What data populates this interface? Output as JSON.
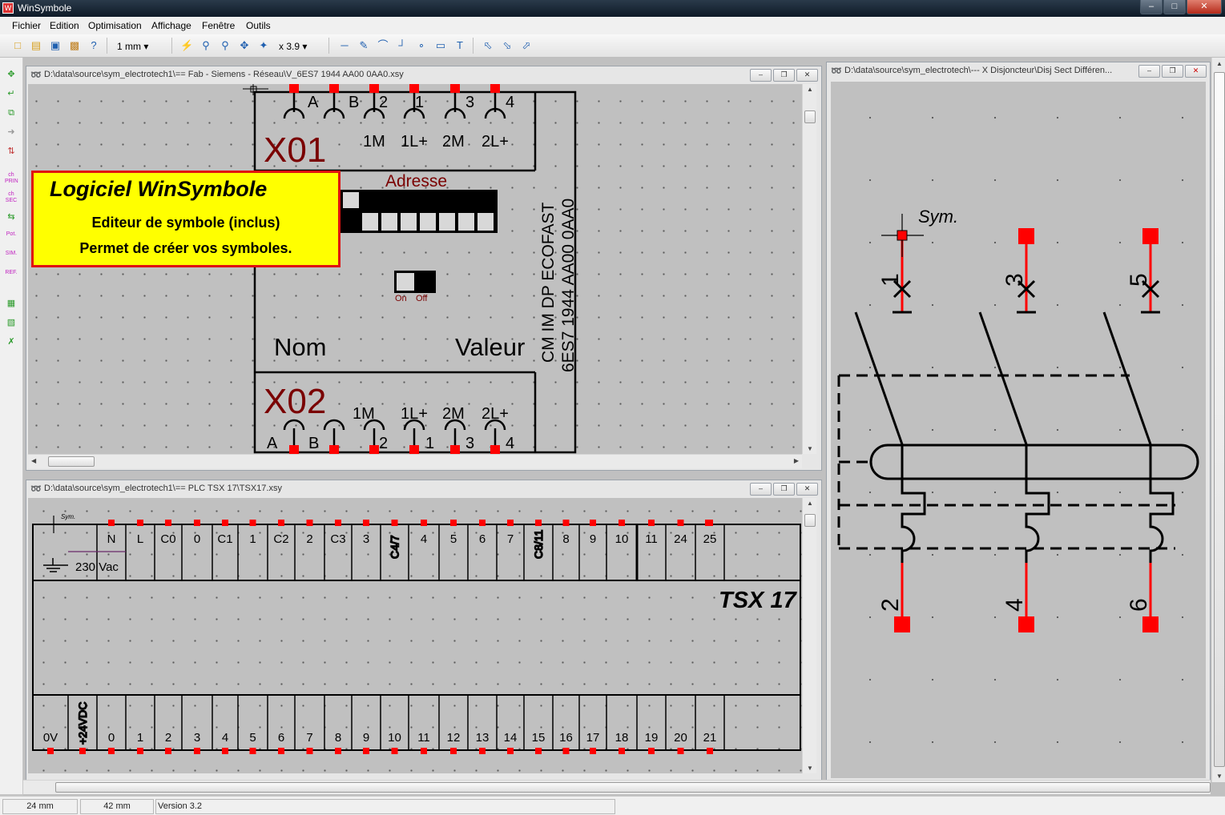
{
  "app": {
    "title": "WinSymbole"
  },
  "menu": [
    "Fichier",
    "Edition",
    "Optimisation",
    "Affichage",
    "Fenêtre",
    "Outils"
  ],
  "toolbar": {
    "grid_size": "1 mm",
    "zoom": "x 3.9"
  },
  "left_toolbar": {
    "labels": [
      "ch PRIN",
      "ch SEC",
      "Pot.",
      "SIM.",
      "REF."
    ]
  },
  "windows": {
    "siemens": {
      "title": "D:\\data\\source\\sym_electrotech1\\== Fab - Siemens - Réseau\\V_6ES7 1944 AA00 0AA0.xsy",
      "top_pins": [
        "A",
        "B",
        "2",
        "1",
        "3",
        "4"
      ],
      "top_labels": [
        "1M",
        "1L+",
        "2M",
        "2L+"
      ],
      "block1": "X01",
      "block2": "X02",
      "adresse": "Adresse",
      "switch_on": "On",
      "switch_off": "Off",
      "nom": "Nom",
      "valeur": "Valeur",
      "vertical1": "CM IM DP ECOFAST",
      "vertical2": "6ES7 1944 AA00 0AA0",
      "bottom_labels": [
        "1M",
        "1L+",
        "2M",
        "2L+"
      ],
      "bottom_pins": [
        "A",
        "B",
        "2",
        "1",
        "3",
        "4"
      ]
    },
    "disj": {
      "title": "D:\\data\\source\\sym_electrotech\\--- X Disjoncteur\\Disj Sect Différen...",
      "sym": "Sym.",
      "top_numbers": [
        "1",
        "3",
        "5"
      ],
      "bottom_numbers": [
        "2",
        "4",
        "6"
      ]
    },
    "tsx": {
      "title": "D:\\data\\source\\sym_electrotech1\\== PLC TSX 17\\TSX17.xsy",
      "sym": "Sym.",
      "top_terms": [
        "N",
        "L",
        "C0",
        "0",
        "C1",
        "1",
        "C2",
        "2",
        "C3",
        "3",
        "C4/7",
        "4",
        "5",
        "6",
        "7",
        "C8/11",
        "8",
        "9",
        "10",
        "11",
        "24",
        "25"
      ],
      "supply": "230 Vac",
      "model": "TSX 17",
      "bottom_terms": [
        "0V",
        "+24VDC",
        "0",
        "1",
        "2",
        "3",
        "4",
        "5",
        "6",
        "7",
        "8",
        "9",
        "10",
        "11",
        "12",
        "13",
        "14",
        "15",
        "16",
        "17",
        "18",
        "19",
        "20",
        "21"
      ]
    }
  },
  "promo": {
    "heading": "Logiciel WinSymbole",
    "line1": "Editeur de symbole (inclus)",
    "line2": "Permet de créer vos symboles."
  },
  "status": {
    "x": "24 mm",
    "y": "42 mm",
    "version": "Version 3.2"
  },
  "colors": {
    "pin": "#ff0000",
    "label_dark_red": "#7a0000",
    "promo_bg": "#ffff00",
    "promo_border": "#e01010"
  }
}
